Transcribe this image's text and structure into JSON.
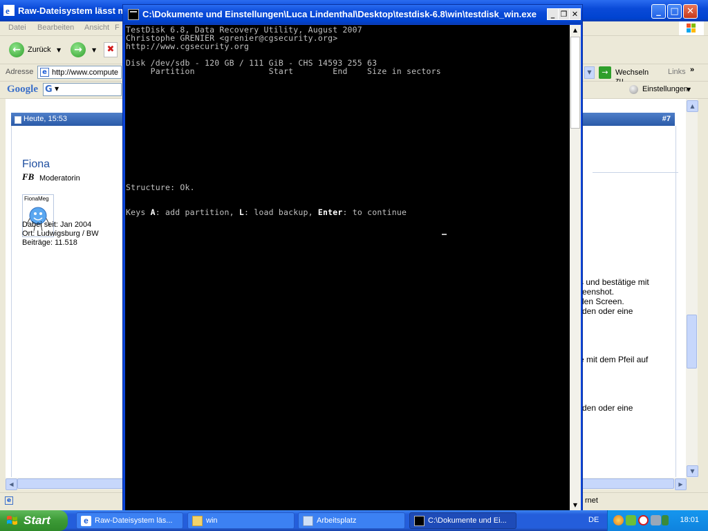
{
  "ie": {
    "title": "Raw-Dateisystem lässt m",
    "menu": [
      "Datei",
      "Bearbeiten",
      "Ansicht",
      "F"
    ],
    "toolbar": {
      "back_label": "Zurück"
    },
    "address": {
      "label": "Adresse",
      "url": "http://www.compute",
      "go_label": "Wechseln zu",
      "links_label": "Links"
    },
    "google": {
      "logo": "Google",
      "settings_label": "Einstellungen"
    },
    "post": {
      "date": "Heute, 15:53",
      "number": "#7",
      "username": "Fiona",
      "usertitle": "Moderatorin",
      "avatar_label": "FionaMeg",
      "joined": "Dabei seit: Jan 2004",
      "location": "Ort: Ludwigsburg / BW",
      "posts": "Beiträge: 11.518",
      "text_fragments": [
        "s und bestätige mit",
        "reenshot.",
        "den Screen.",
        "rden oder eine",
        "e mit dem Pfeil auf",
        "rden oder eine"
      ]
    },
    "status_fragment": "rnet"
  },
  "console": {
    "title": "C:\\Dokumente und Einstellungen\\Luca Lindenthal\\Desktop\\testdisk-6.8\\win\\testdisk_win.exe",
    "lines": {
      "l1": "TestDisk 6.8, Data Recovery Utility, August 2007",
      "l2": "Christophe GRENIER <grenier@cgsecurity.org>",
      "l3": "http://www.cgsecurity.org",
      "l4": "Disk /dev/sdb - 120 GB / 111 GiB - CHS 14593 255 63",
      "l5": "     Partition               Start        End    Size in sectors",
      "l6": "Structure: Ok."
    },
    "keys": {
      "prefix": "Keys ",
      "key_a": "A",
      "text_a": ": add partition, ",
      "key_l": "L",
      "text_l": ": load backup, ",
      "key_enter": "Enter",
      "text_enter": ": to continue"
    }
  },
  "taskbar": {
    "start_label": "Start",
    "tasks": [
      "Raw-Dateisystem läs...",
      "win",
      "Arbeitsplatz",
      "C:\\Dokumente und Ei..."
    ],
    "language": "DE",
    "clock": "18:01"
  },
  "colors": {
    "xp_blue": "#0a4ad8",
    "console_bg": "#000000",
    "console_text": "#c0c0c0",
    "start_green": "#3c9a36"
  }
}
